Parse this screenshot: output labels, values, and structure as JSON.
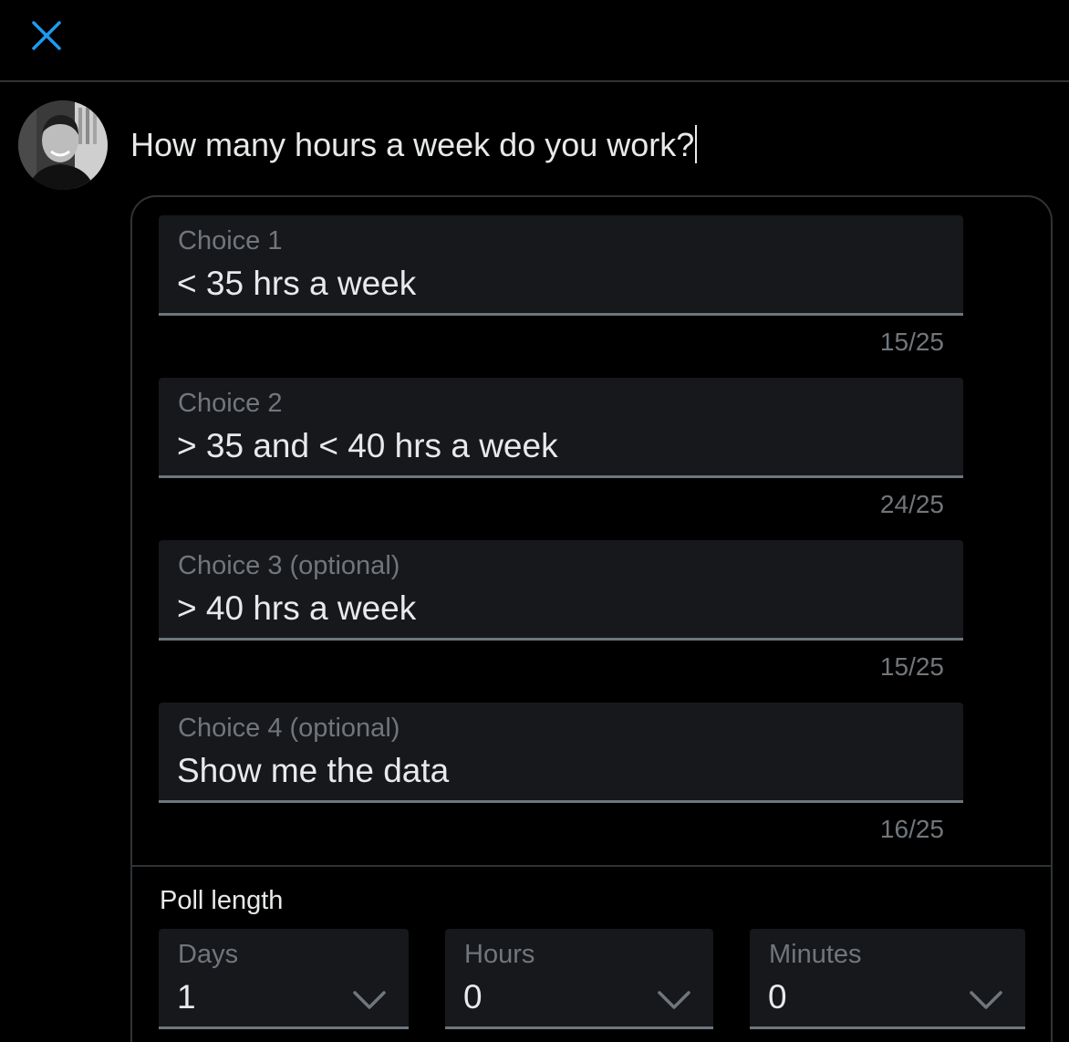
{
  "header": {
    "close_icon": "close-icon",
    "accent_color": "#1d9bf0"
  },
  "composer": {
    "avatar_icon": "user-avatar",
    "question": "How many hours a week do you work?"
  },
  "poll": {
    "choices": [
      {
        "label": "Choice 1",
        "value": "< 35 hrs a week",
        "counter": "15/25"
      },
      {
        "label": "Choice 2",
        "value": "> 35 and < 40 hrs a week",
        "counter": "24/25"
      },
      {
        "label": "Choice 3 (optional)",
        "value": "> 40 hrs a week",
        "counter": "15/25"
      },
      {
        "label": "Choice 4 (optional)",
        "value": "Show me the data",
        "counter": "16/25"
      }
    ],
    "length": {
      "title": "Poll length",
      "days": {
        "label": "Days",
        "value": "1"
      },
      "hours": {
        "label": "Hours",
        "value": "0"
      },
      "minutes": {
        "label": "Minutes",
        "value": "0"
      }
    }
  }
}
